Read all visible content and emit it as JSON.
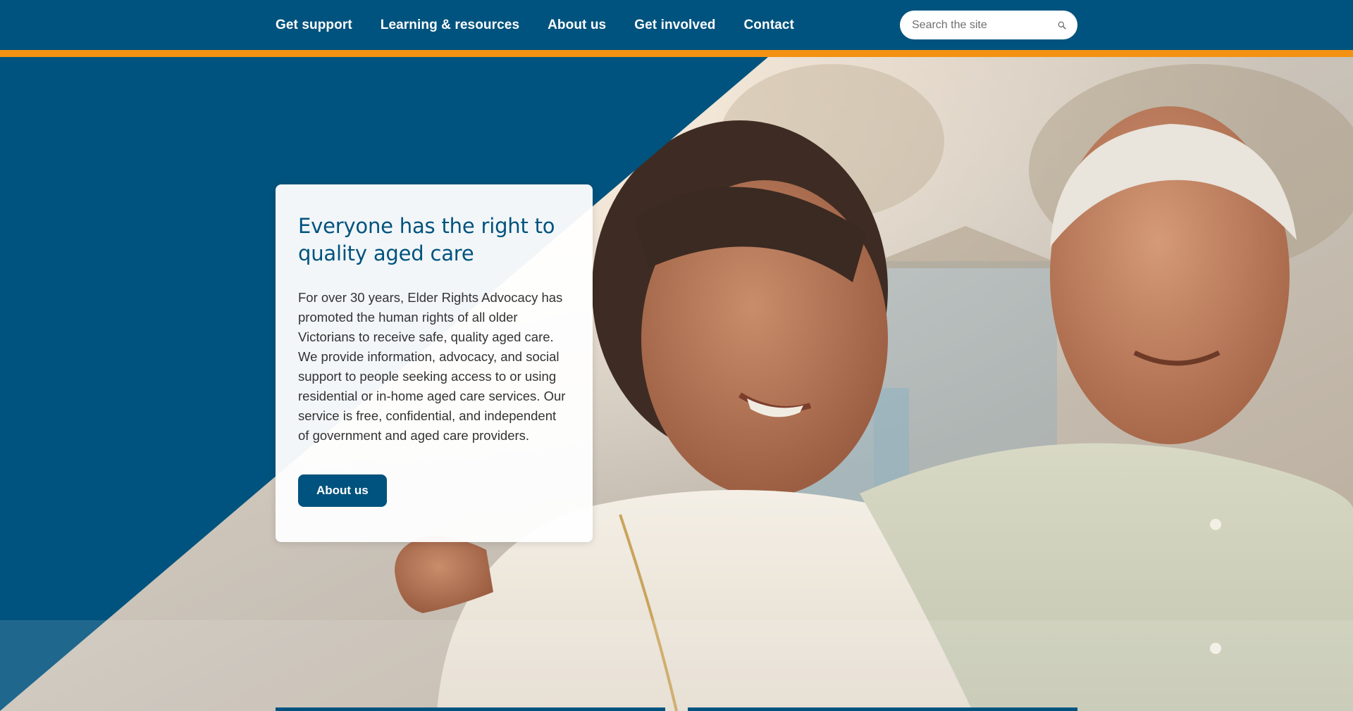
{
  "nav": {
    "items": [
      {
        "label": "Get support"
      },
      {
        "label": "Learning & resources"
      },
      {
        "label": "About us"
      },
      {
        "label": "Get involved"
      },
      {
        "label": "Contact"
      }
    ]
  },
  "search": {
    "placeholder": "Search the site",
    "icon": "search-icon"
  },
  "hero": {
    "title": "Everyone has the right to quality aged care",
    "body": "For over 30 years, Elder Rights Advocacy has promoted the human rights of all older Victorians to receive safe, quality aged care. We provide information, advocacy, and social support to people seeking access to or using residential or in-home aged care services. Our service is free, confidential, and independent of government and aged care providers.",
    "button_label": "About us"
  },
  "colors": {
    "brand_blue": "#00537e",
    "accent_orange": "#f39212",
    "white": "#ffffff"
  }
}
